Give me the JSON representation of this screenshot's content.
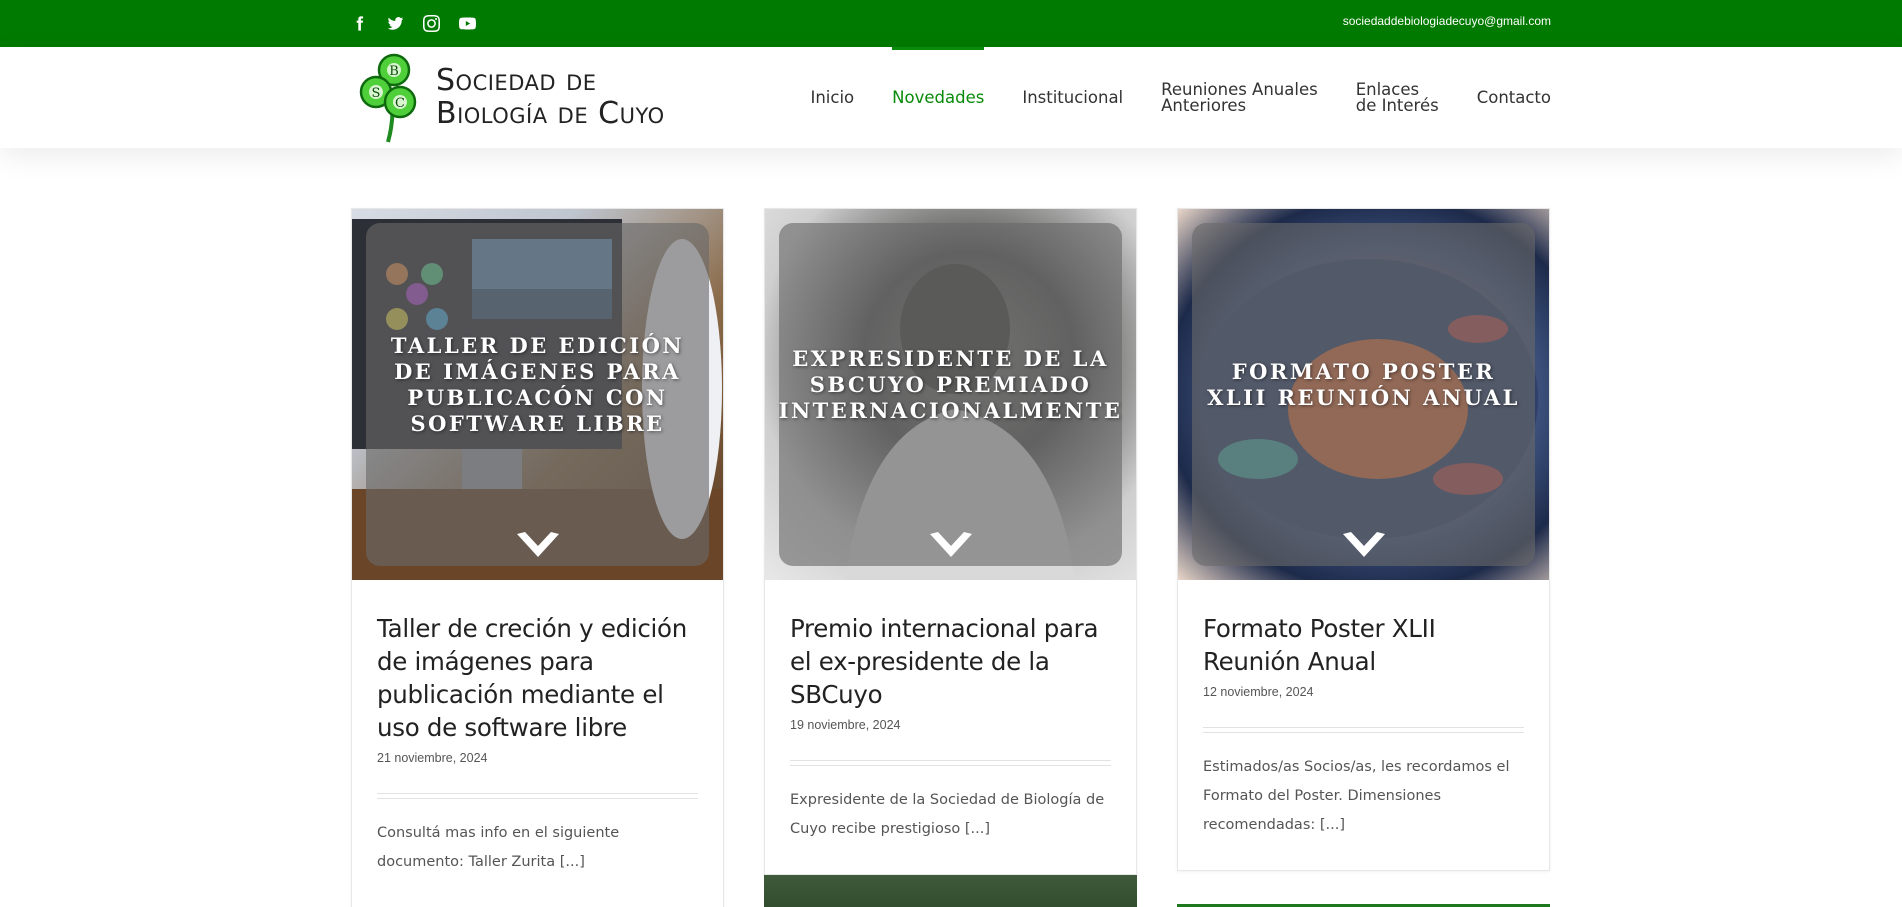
{
  "topbar": {
    "social": [
      {
        "icon": "facebook-icon",
        "label": "Facebook"
      },
      {
        "icon": "twitter-icon",
        "label": "Twitter"
      },
      {
        "icon": "instagram-icon",
        "label": "Instagram"
      },
      {
        "icon": "youtube-icon",
        "label": "YouTube"
      }
    ],
    "email": "sociedaddebiologiadecuyo@gmail.com",
    "bg_color": "#017a01"
  },
  "header": {
    "logo_line1": "Sociedad de",
    "logo_line2": "Biología de Cuyo",
    "logo_letters": [
      "B",
      "S",
      "C"
    ],
    "nav": [
      {
        "line1": "Inicio",
        "line2": "",
        "active": false
      },
      {
        "line1": "Novedades",
        "line2": "",
        "active": true
      },
      {
        "line1": "Institucional",
        "line2": "",
        "active": false
      },
      {
        "line1": "Reuniones Anuales",
        "line2": "Anteriores",
        "active": false
      },
      {
        "line1": "Enlaces",
        "line2": "de Interés",
        "active": false
      },
      {
        "line1": "Contacto",
        "line2": "",
        "active": false
      }
    ],
    "accent_color": "#0a8a0a"
  },
  "posts": [
    {
      "overlay_title": "Taller de edición de imágenes para publicacón con software libre",
      "title": "Taller de creción y edición de imágenes para publicación mediante el uso de software libre",
      "date": "21 noviembre, 2024",
      "excerpt": " Consultá mas info en el siguiente documento: Taller Zurita [...]"
    },
    {
      "overlay_title": "Expresidente de la SBCuyo premiado internacionalmente",
      "title": "Premio internacional para el ex-presidente de la SBCuyo",
      "date": "19 noviembre, 2024",
      "excerpt": "Expresidente de la Sociedad de Biología de Cuyo recibe prestigioso [...]"
    },
    {
      "overlay_title": "Formato Poster XLII Reunión Anual",
      "title": "Formato Poster XLII Reunión Anual",
      "date": "12 noviembre, 2024",
      "excerpt": "Estimados/as Socios/as, les recordamos el Formato del Poster. Dimensiones recomendadas: [...]"
    }
  ]
}
